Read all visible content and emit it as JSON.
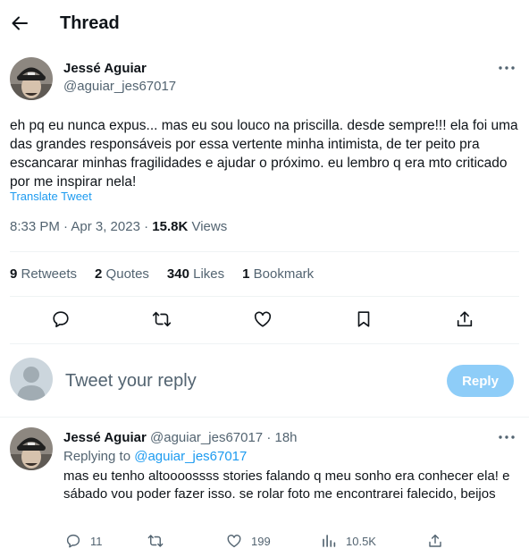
{
  "header": {
    "title": "Thread",
    "back_icon": "back-arrow-icon"
  },
  "tweet": {
    "author_name": "Jessé Aguiar",
    "author_handle": "@aguiar_jes67017",
    "text": "eh pq eu nunca expus... mas eu sou louco na priscilla. desde sempre!!! ela foi uma das grandes responsáveis por essa vertente minha intimista, de ter peito pra escancarar minhas fragilidades e ajudar o próximo. eu lembro q era mto criticado por me inspirar nela!",
    "translate_label": "Translate Tweet",
    "time": "8:33 PM · Apr 3, 2023 · ",
    "views_count": "15.8K",
    "views_label": " Views"
  },
  "stats": {
    "retweets_count": "9",
    "retweets_label": " Retweets",
    "quotes_count": "2",
    "quotes_label": " Quotes",
    "likes_count": "340",
    "likes_label": " Likes",
    "bookmarks_count": "1",
    "bookmarks_label": " Bookmark"
  },
  "actions": [
    "reply-icon",
    "retweet-icon",
    "like-icon",
    "bookmark-icon",
    "share-icon"
  ],
  "compose": {
    "placeholder": "Tweet your reply",
    "button_label": "Reply"
  },
  "reply": {
    "author_name": "Jessé Aguiar",
    "author_handle": "@aguiar_jes67017",
    "time": " · 18h",
    "replying_prefix": "Replying to ",
    "replying_handle": "@aguiar_jes67017",
    "text": "mas eu tenho altoooossss stories falando q meu sonho era conhecer ela! e sábado vou poder fazer isso. se rolar foto me encontrarei falecido, beijos",
    "reply_count": "11",
    "like_count": "199",
    "views_count": "10.5K"
  },
  "colors": {
    "accent": "#1d9bf0",
    "reply_button_disabled": "#8ecdf8",
    "secondary_text": "#536471",
    "divider": "#eff3f4"
  }
}
